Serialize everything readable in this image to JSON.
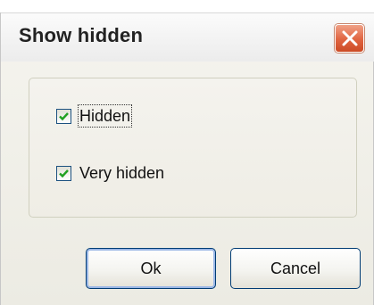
{
  "dialog": {
    "title": "Show hidden",
    "close_icon": "close-icon"
  },
  "options": [
    {
      "label": "Hidden",
      "checked": true
    },
    {
      "label": "Very hidden",
      "checked": true
    }
  ],
  "buttons": {
    "ok_label": "Ok",
    "cancel_label": "Cancel"
  },
  "colors": {
    "close_button": "#e06440",
    "checkmark": "#21a121",
    "dialog_bg": "#ecebe3"
  }
}
